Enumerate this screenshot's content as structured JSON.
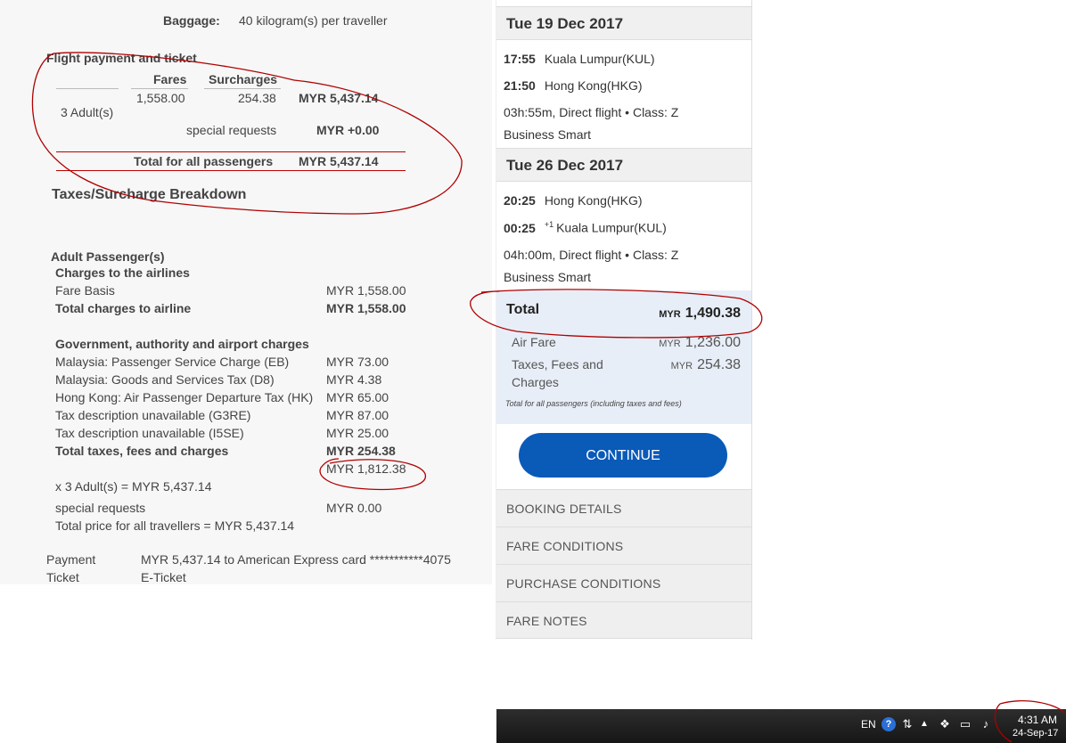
{
  "left": {
    "baggage_label": "Baggage:",
    "baggage_value": "40 kilogram(s) per traveller",
    "payment_title": "Flight payment and ticket",
    "col_fares": "Fares",
    "col_surcharges": "Surcharges",
    "adults_label": "3 Adult(s)",
    "fare_value": "1,558.00",
    "surcharge_value": "254.38",
    "row_total": "MYR 5,437.14",
    "special_requests_label": "special requests",
    "special_requests_value": "MYR +0.00",
    "total_all_label": "Total for all passengers",
    "total_all_value": "MYR 5,437.14",
    "breakdown_title": "Taxes/Surcharge Breakdown",
    "adult_passengers": "Adult Passenger(s)",
    "charges_airlines": "Charges to the airlines",
    "fare_basis_label": "Fare Basis",
    "fare_basis_value": "MYR 1,558.00",
    "total_airline_label": "Total charges to airline",
    "total_airline_value": "MYR 1,558.00",
    "gov_title": "Government, authority and airport charges",
    "taxes": [
      {
        "label": "Malaysia: Passenger Service Charge (EB)",
        "value": "MYR 73.00"
      },
      {
        "label": "Malaysia: Goods and Services Tax (D8)",
        "value": "MYR 4.38"
      },
      {
        "label": "Hong Kong: Air Passenger Departure Tax (HK)",
        "value": "MYR 65.00"
      },
      {
        "label": "Tax description unavailable (G3RE)",
        "value": "MYR 87.00"
      },
      {
        "label": "Tax description unavailable (I5SE)",
        "value": "MYR 25.00"
      }
    ],
    "total_taxes_label": "Total taxes, fees and charges",
    "total_taxes_value": "MYR 254.38",
    "per_adult_value": "MYR 1,812.38",
    "x_adults": "x 3 Adult(s) = MYR 5,437.14",
    "special_req2_label": "special requests",
    "special_req2_value": "MYR 0.00",
    "total_price": "Total price for all travellers = MYR 5,437.14",
    "payment_label": "Payment",
    "payment_value": "MYR 5,437.14 to American Express card ***********4075",
    "ticket_label": "Ticket",
    "ticket_value": "E-Ticket"
  },
  "right": {
    "outbound_date": "Tue 19 Dec 2017",
    "out_dep_time": "17:55",
    "out_dep_city": "Kuala Lumpur(KUL)",
    "out_arr_time": "21:50",
    "out_arr_city": "Hong Kong(HKG)",
    "out_info": "03h:55m, Direct flight • Class: Z",
    "out_fare": "Business Smart",
    "return_date": "Tue 26 Dec 2017",
    "ret_dep_time": "20:25",
    "ret_dep_city": "Hong Kong(HKG)",
    "ret_arr_time": "00:25",
    "ret_arr_sup": "+1",
    "ret_arr_city": "Kuala Lumpur(KUL)",
    "ret_info": "04h:00m, Direct flight • Class: Z",
    "ret_fare": "Business Smart",
    "total_label": "Total",
    "currency": "MYR",
    "total_value": "1,490.38",
    "air_fare_label": "Air Fare",
    "air_fare_value": "1,236.00",
    "taxes_label_1": "Taxes, Fees and",
    "taxes_label_2": "Charges",
    "taxes_value": "254.38",
    "total_note": "Total for all passengers (including taxes and fees)",
    "continue_label": "CONTINUE",
    "accordion": [
      "BOOKING DETAILS",
      "FARE CONDITIONS",
      "PURCHASE CONDITIONS",
      "FARE NOTES"
    ]
  },
  "taskbar": {
    "lang": "EN",
    "time": "4:31 AM",
    "date": "24-Sep-17",
    "icons": [
      "help-icon",
      "network-icon",
      "arrow-up-icon",
      "dropbox-icon",
      "display-icon",
      "volume-icon"
    ]
  },
  "colors": {
    "continue_bg": "#0a5ab8",
    "total_box_bg": "#e8eef7",
    "annotation": "#b00000"
  }
}
